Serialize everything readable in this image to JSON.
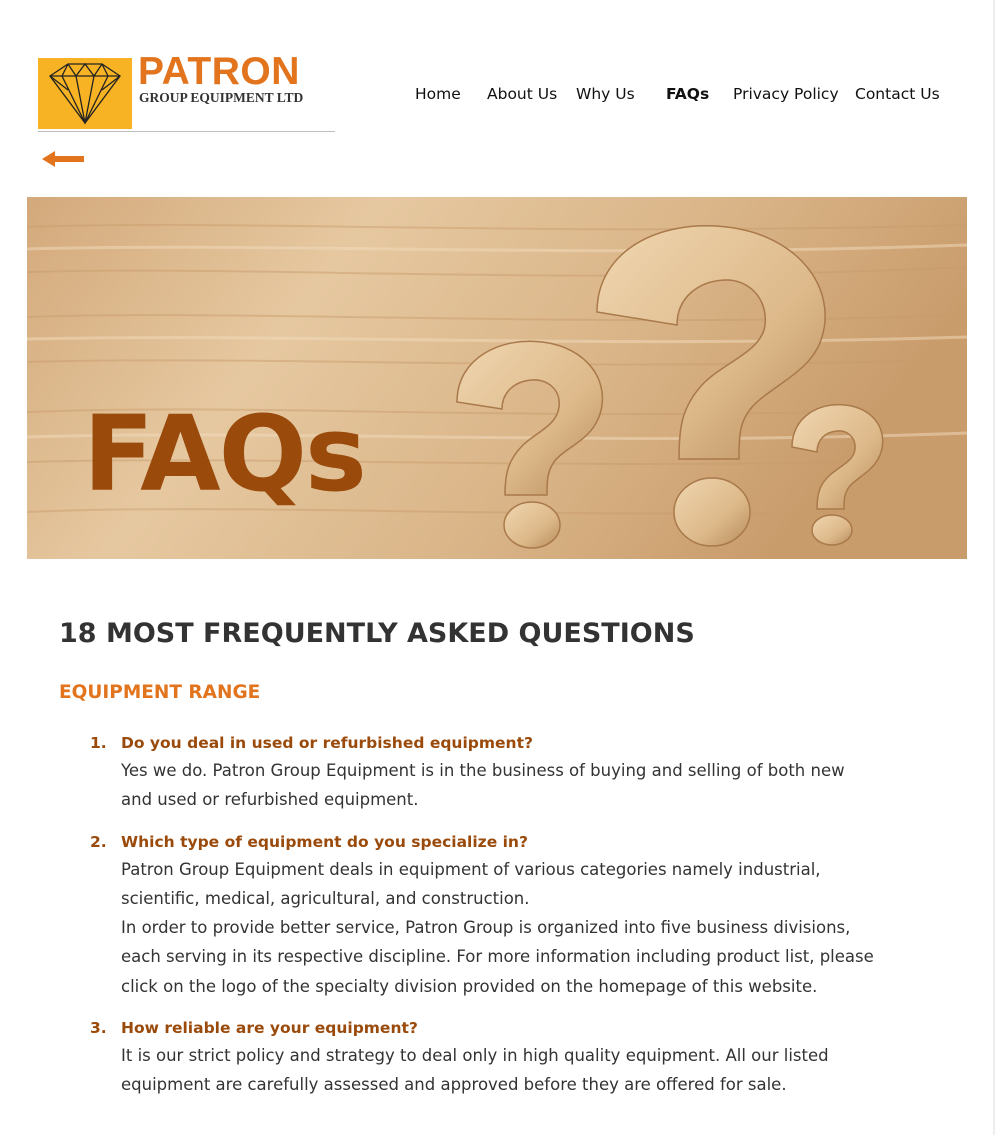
{
  "brand": {
    "name": "PATRON",
    "subtitle": "GROUP EQUIPMENT LTD",
    "logo_color": "#f7b324",
    "accent_color": "#e2741d",
    "dark_accent_color": "#9a4a0b"
  },
  "nav": {
    "items": [
      {
        "label": "Home",
        "active": false
      },
      {
        "label": "About Us",
        "active": false
      },
      {
        "label": "Why Us",
        "active": false
      },
      {
        "label": "FAQs",
        "active": true
      },
      {
        "label": "Privacy Policy",
        "active": false
      },
      {
        "label": "Contact Us",
        "active": false
      }
    ]
  },
  "back_button": {
    "icon": "arrow-left-icon"
  },
  "hero": {
    "title": "FAQs",
    "image": "wooden question marks on wood background"
  },
  "content": {
    "heading": "18 MOST FREQUENTLY ASKED QUESTIONS",
    "section_title": "EQUIPMENT RANGE",
    "faqs": [
      {
        "number": "1.",
        "question": "Do you deal in used or refurbished equipment?",
        "answer": [
          "Yes we do. Patron Group Equipment is in the business of buying and selling of both new and used or refurbished equipment."
        ]
      },
      {
        "number": "2.",
        "question": "Which type of equipment do you specialize in?",
        "answer": [
          "Patron Group Equipment deals in equipment of various categories namely industrial, scientific, medical, agricultural, and construction.",
          "In order to provide better service, Patron Group is organized into five business divisions, each serving in its respective discipline. For more information including product list, please click on the logo of the specialty division provided on the homepage of this website."
        ]
      },
      {
        "number": "3.",
        "question": "How reliable are your equipment?",
        "answer": [
          "It is our strict policy and strategy to deal only in high quality equipment. All our listed equipment are carefully assessed and approved before they are offered for sale."
        ]
      }
    ]
  }
}
